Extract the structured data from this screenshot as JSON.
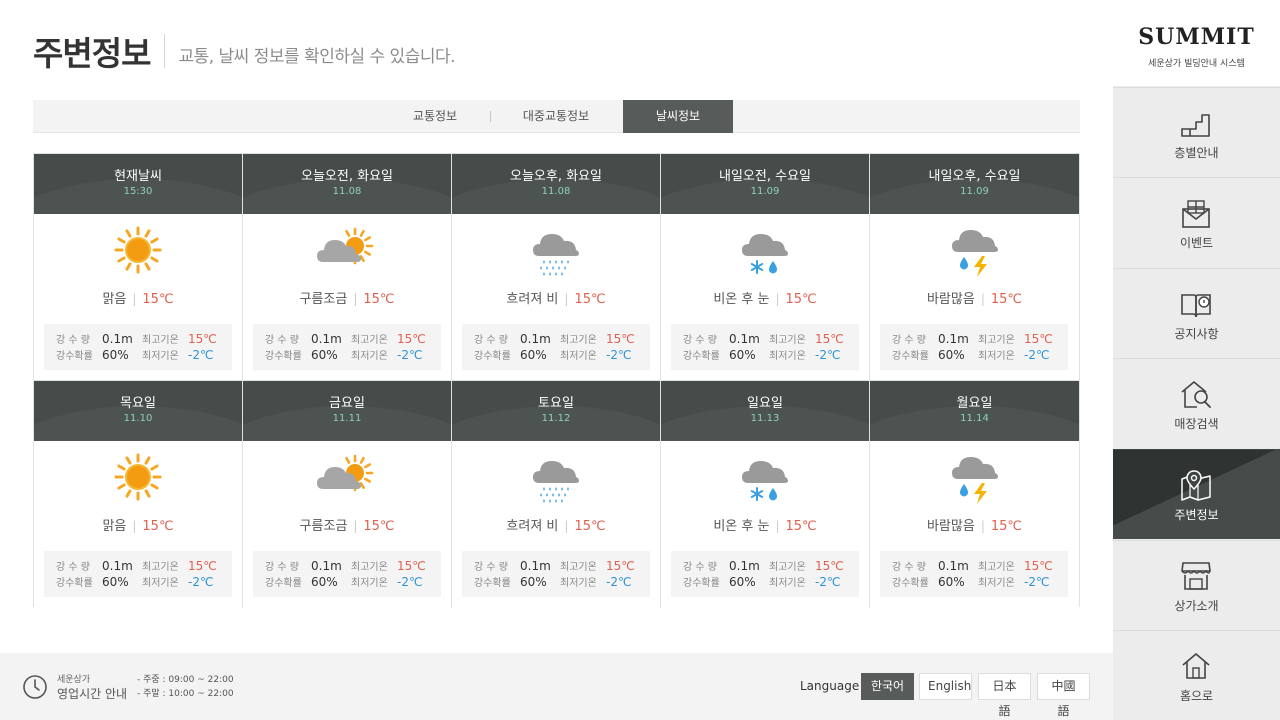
{
  "header": {
    "title": "주변정보",
    "subtitle": "교통, 날씨 정보를 확인하실 수 있습니다."
  },
  "tabs": [
    {
      "label": "교통정보",
      "active": false
    },
    {
      "label": "대중교통정보",
      "active": false
    },
    {
      "label": "날씨정보",
      "active": true
    }
  ],
  "labels": {
    "rain_amount": "강 수 량",
    "rain_prob": "강수확률",
    "max_temp": "최고기온",
    "min_temp": "최저기온"
  },
  "colors": {
    "header_bg": "#464c4a",
    "date_text": "#8fd1b6",
    "temp_high": "#e0604e",
    "temp_low": "#2e93d6",
    "active_tab": "#575c5a"
  },
  "cards": [
    {
      "label": "현재날씨",
      "date": "15:30",
      "icon": "sun-icon",
      "condition": "맑음",
      "temp": "15℃",
      "rain_amount": "0.1m",
      "rain_prob": "60%",
      "max": "15℃",
      "min": "-2℃"
    },
    {
      "label": "오늘오전, 화요일",
      "date": "11.08",
      "icon": "partly-cloudy-icon",
      "condition": "구름조금",
      "temp": "15℃",
      "rain_amount": "0.1m",
      "rain_prob": "60%",
      "max": "15℃",
      "min": "-2℃"
    },
    {
      "label": "오늘오후, 화요일",
      "date": "11.08",
      "icon": "rain-icon",
      "condition": "흐려져 비",
      "temp": "15℃",
      "rain_amount": "0.1m",
      "rain_prob": "60%",
      "max": "15℃",
      "min": "-2℃"
    },
    {
      "label": "내일오전, 수요일",
      "date": "11.09",
      "icon": "rain-snow-icon",
      "condition": "비온 후 눈",
      "temp": "15℃",
      "rain_amount": "0.1m",
      "rain_prob": "60%",
      "max": "15℃",
      "min": "-2℃"
    },
    {
      "label": "내일오후, 수요일",
      "date": "11.09",
      "icon": "storm-icon",
      "condition": "바람많음",
      "temp": "15℃",
      "rain_amount": "0.1m",
      "rain_prob": "60%",
      "max": "15℃",
      "min": "-2℃"
    },
    {
      "label": "목요일",
      "date": "11.10",
      "icon": "sun-icon",
      "condition": "맑음",
      "temp": "15℃",
      "rain_amount": "0.1m",
      "rain_prob": "60%",
      "max": "15℃",
      "min": "-2℃"
    },
    {
      "label": "금요일",
      "date": "11.11",
      "icon": "partly-cloudy-icon",
      "condition": "구름조금",
      "temp": "15℃",
      "rain_amount": "0.1m",
      "rain_prob": "60%",
      "max": "15℃",
      "min": "-2℃"
    },
    {
      "label": "토요일",
      "date": "11.12",
      "icon": "rain-icon",
      "condition": "흐려져 비",
      "temp": "15℃",
      "rain_amount": "0.1m",
      "rain_prob": "60%",
      "max": "15℃",
      "min": "-2℃"
    },
    {
      "label": "일요일",
      "date": "11.13",
      "icon": "rain-snow-icon",
      "condition": "비온 후 눈",
      "temp": "15℃",
      "rain_amount": "0.1m",
      "rain_prob": "60%",
      "max": "15℃",
      "min": "-2℃"
    },
    {
      "label": "월요일",
      "date": "11.14",
      "icon": "storm-icon",
      "condition": "바람많음",
      "temp": "15℃",
      "rain_amount": "0.1m",
      "rain_prob": "60%",
      "max": "15℃",
      "min": "-2℃"
    }
  ],
  "footer": {
    "company": "세운상가",
    "hours_title": "영업시간 안내",
    "weekday": "- 주중 : 09:00 ~ 22:00",
    "weekend": "- 주말 : 10:00 ~ 22:00",
    "language_label": "Language",
    "languages": [
      {
        "label": "한국어",
        "active": true
      },
      {
        "label": "English",
        "active": false
      },
      {
        "label": "日本語",
        "active": false
      },
      {
        "label": "中國語",
        "active": false
      }
    ]
  },
  "sidebar": {
    "brand": "SUMMIT",
    "brand_sub": "세운상가 빌딩안내 시스템",
    "items": [
      {
        "label": "층별안내",
        "icon": "stairs-icon",
        "active": false
      },
      {
        "label": "이벤트",
        "icon": "gift-icon",
        "active": false
      },
      {
        "label": "공지사항",
        "icon": "notice-book-icon",
        "active": false
      },
      {
        "label": "매장검색",
        "icon": "store-search-icon",
        "active": false
      },
      {
        "label": "주변정보",
        "icon": "map-pin-icon",
        "active": true
      },
      {
        "label": "상가소개",
        "icon": "shop-icon",
        "active": false
      },
      {
        "label": "홈으로",
        "icon": "home-icon",
        "active": false
      }
    ]
  }
}
